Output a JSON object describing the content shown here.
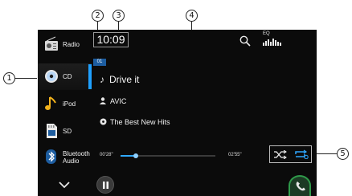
{
  "sidebar": {
    "items": [
      {
        "label": "Radio",
        "icon": "radio-icon",
        "active": false
      },
      {
        "label": "CD",
        "icon": "cd-icon",
        "active": true
      },
      {
        "label": "iPod",
        "icon": "music-note-icon",
        "active": false
      },
      {
        "label": "SD",
        "icon": "sd-card-icon",
        "active": false
      },
      {
        "label": "Bluetooth Audio",
        "label_line1": "Bluetooth",
        "label_line2": "Audio",
        "icon": "bluetooth-icon",
        "active": false
      }
    ],
    "more_icon": "chevron-down-icon"
  },
  "header": {
    "clock": "10:09",
    "eq_label": "EQ",
    "search_icon": "search-icon",
    "eq_icon": "equalizer-icon"
  },
  "track": {
    "number": "01",
    "title": "Drive it",
    "artist": "AVIC",
    "album": "The Best New Hits",
    "elapsed": "00'28\"",
    "total": "02'55\"",
    "progress": 0.16
  },
  "controls": {
    "shuffle_icon": "shuffle-icon",
    "repeat_icon": "repeat-icon",
    "pause_icon": "pause-icon",
    "phone_icon": "phone-icon"
  },
  "callouts": {
    "c1": "1",
    "c2": "2",
    "c3": "3",
    "c4": "4",
    "c5": "5"
  },
  "colors": {
    "accent": "#1fa0ff",
    "background": "#0b0b0b",
    "track_number_bg": "#1d5da0",
    "phone_button": "#2f9a4a"
  }
}
